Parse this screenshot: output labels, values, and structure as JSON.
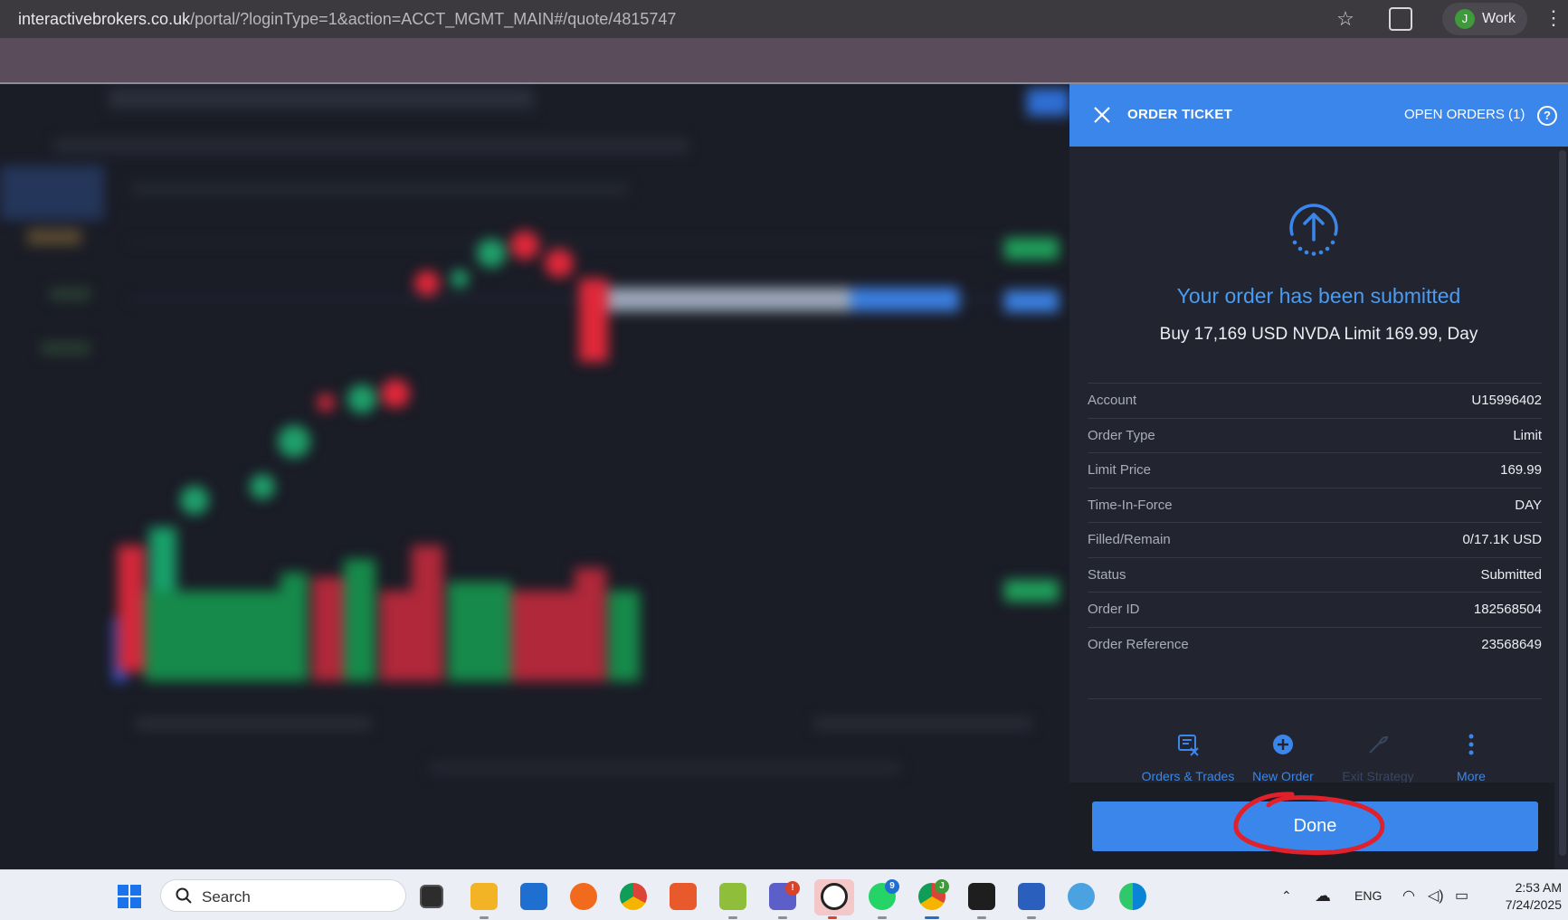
{
  "browser": {
    "url_host": "interactivebrokers.co.uk",
    "url_path": "/portal/?loginType=1&action=ACCT_MGMT_MAIN#/quote/4815747",
    "profile_initial": "J",
    "profile_name": "Work"
  },
  "ticket": {
    "title": "ORDER TICKET",
    "open_orders": "OPEN ORDERS (1)",
    "help": "?",
    "status_message": "Your order has been submitted",
    "summary": "Buy 17,169 USD NVDA Limit 169.99, Day",
    "details": [
      {
        "label": "Account",
        "value": "U15996402"
      },
      {
        "label": "Order Type",
        "value": "Limit"
      },
      {
        "label": "Limit Price",
        "value": "169.99"
      },
      {
        "label": "Time-In-Force",
        "value": "DAY"
      },
      {
        "label": "Filled/Remain",
        "value": "0/17.1K USD"
      },
      {
        "label": "Status",
        "value": "Submitted"
      },
      {
        "label": "Order ID",
        "value": "182568504"
      },
      {
        "label": "Order Reference",
        "value": "23568649"
      }
    ],
    "actions": [
      {
        "label": "Orders & Trades",
        "icon": "orders-trades-icon"
      },
      {
        "label": "New Order",
        "icon": "plus-circle-icon"
      },
      {
        "label": "Exit Strategy",
        "icon": "exit-strategy-icon"
      },
      {
        "label": "More",
        "icon": "more-vertical-icon"
      }
    ],
    "done_label": "Done"
  },
  "taskbar": {
    "search_placeholder": "Search",
    "lang": "ENG",
    "time": "2:53 AM",
    "date": "7/24/2025",
    "whatsapp_badge": "9",
    "chrome_badge": "J",
    "teams_badge": "!"
  },
  "colors": {
    "accent": "#3b86ea",
    "panel_bg": "#22252f",
    "annotation": "#e0202a"
  }
}
